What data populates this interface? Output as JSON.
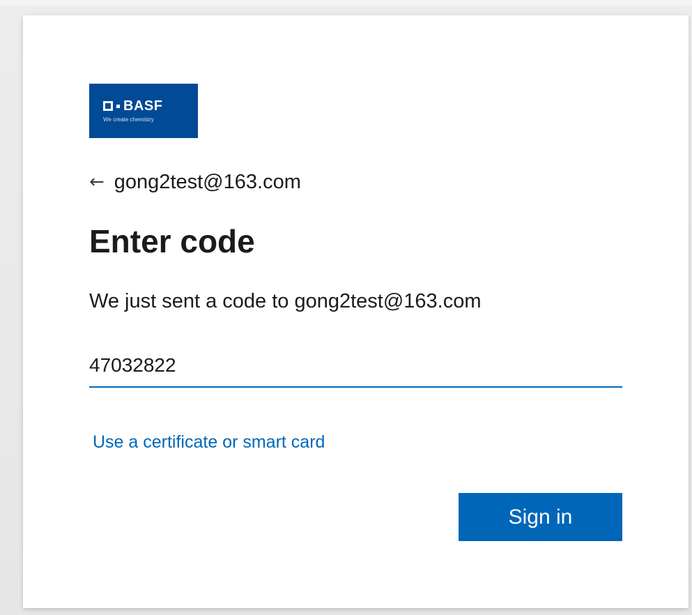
{
  "brand": {
    "name": "BASF",
    "tagline": "We create chemistry",
    "color": "#004a96"
  },
  "identity": {
    "back_icon": "back-arrow-icon",
    "email": "gong2test@163.com"
  },
  "heading": "Enter code",
  "description": "We just sent a code to gong2test@163.com",
  "code_field": {
    "value": "47032822",
    "placeholder": ""
  },
  "links": {
    "certificate": "Use a certificate or smart card"
  },
  "actions": {
    "sign_in": "Sign in"
  },
  "colors": {
    "accent": "#0067b8",
    "text": "#1b1b1b"
  }
}
